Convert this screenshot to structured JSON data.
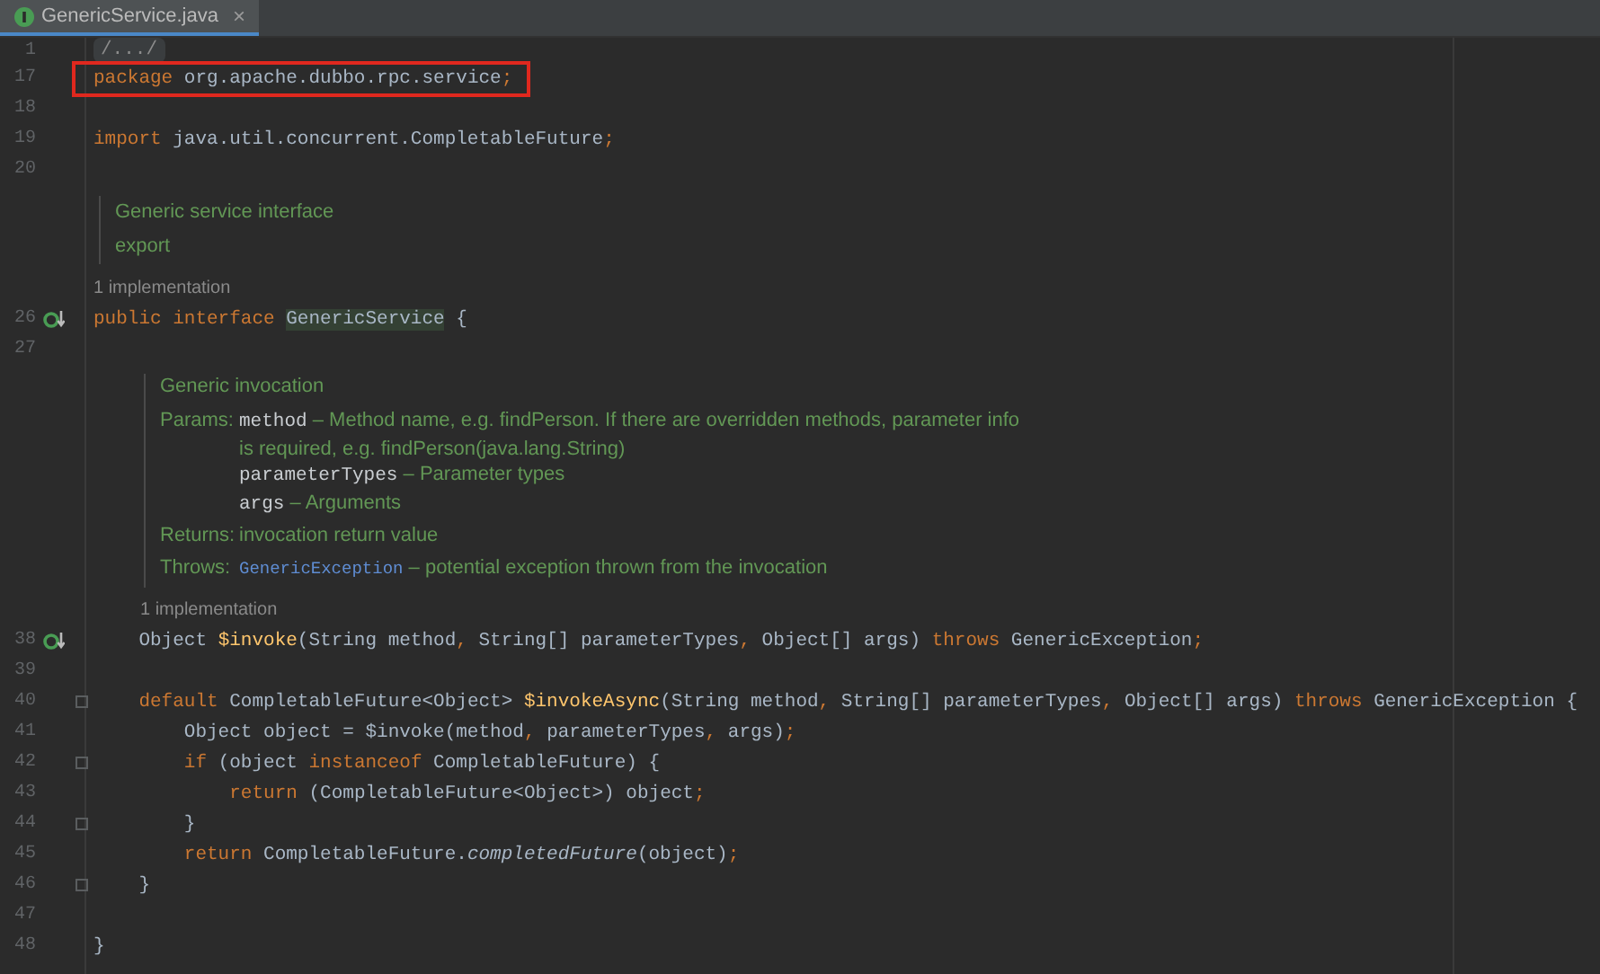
{
  "tab": {
    "label": "GenericService.java",
    "selected": true,
    "close": "×"
  },
  "lines": [
    {
      "kind": "folded",
      "number": "1",
      "text": "/.../"
    },
    {
      "kind": "code",
      "number": "17",
      "boxed": true,
      "tokens": [
        {
          "kind": "kw",
          "text": "package "
        },
        {
          "kind": "plain",
          "text": "org.apache.dubbo.rpc.service"
        },
        {
          "kind": "punct",
          "text": ";"
        }
      ]
    },
    {
      "kind": "blank",
      "number": "18"
    },
    {
      "kind": "code",
      "number": "19",
      "tokens": [
        {
          "kind": "kw",
          "text": "import "
        },
        {
          "kind": "plain",
          "text": "java.util.concurrent.CompletableFuture"
        },
        {
          "kind": "punct",
          "text": ";"
        }
      ]
    },
    {
      "kind": "blank",
      "number": "20"
    },
    {
      "kind": "doc",
      "paragraphs": [
        "Generic service interface",
        "export"
      ]
    },
    {
      "kind": "hint",
      "text": "1 implementation"
    },
    {
      "kind": "code",
      "number": "26",
      "implemented": true,
      "tokens": [
        {
          "kind": "kw",
          "text": "public interface "
        },
        {
          "kind": "hl",
          "text": "GenericService"
        },
        {
          "kind": "plain",
          "text": " {"
        }
      ]
    },
    {
      "kind": "blank",
      "number": "27"
    },
    {
      "kind": "member_doc",
      "paragraphs": [
        "Generic invocation"
      ],
      "sections": [
        {
          "label": "Params:",
          "rows": [
            [
              {
                "kind": "code",
                "text": "method"
              },
              {
                "kind": "text",
                "text": " – Method name, e.g. findPerson. If there are overridden methods, parameter info"
              }
            ],
            [
              {
                "kind": "text",
                "text": "is required, e.g. findPerson(java.lang.String)"
              }
            ],
            [
              {
                "kind": "code",
                "text": "parameterTypes"
              },
              {
                "kind": "text",
                "text": " – Parameter types"
              }
            ],
            [
              {
                "kind": "code",
                "text": "args"
              },
              {
                "kind": "text",
                "text": " – Arguments"
              }
            ]
          ]
        },
        {
          "label": "Returns:",
          "rows": [
            [
              {
                "kind": "text",
                "text": "invocation return value"
              }
            ]
          ]
        },
        {
          "label": "Throws:",
          "rows": [
            [
              {
                "kind": "link",
                "text": "GenericException"
              },
              {
                "kind": "text",
                "text": " – potential exception thrown from the invocation"
              }
            ]
          ]
        }
      ]
    },
    {
      "kind": "member_hint",
      "text": "1 implementation"
    },
    {
      "kind": "code",
      "number": "38",
      "implemented": true,
      "tokens": [
        {
          "kind": "plain",
          "text": "    Object "
        },
        {
          "kind": "decl",
          "text": "$invoke"
        },
        {
          "kind": "plain",
          "text": "(String method"
        },
        {
          "kind": "punct",
          "text": ", "
        },
        {
          "kind": "plain",
          "text": "String[] parameterTypes"
        },
        {
          "kind": "punct",
          "text": ", "
        },
        {
          "kind": "plain",
          "text": "Object[] args) "
        },
        {
          "kind": "kw",
          "text": "throws "
        },
        {
          "kind": "plain",
          "text": "GenericException"
        },
        {
          "kind": "punct",
          "text": ";"
        }
      ]
    },
    {
      "kind": "blank",
      "number": "39"
    },
    {
      "kind": "code",
      "number": "40",
      "fold": true,
      "tokens": [
        {
          "kind": "kw",
          "text": "    default "
        },
        {
          "kind": "plain",
          "text": "CompletableFuture<Object> "
        },
        {
          "kind": "decl",
          "text": "$invokeAsync"
        },
        {
          "kind": "plain",
          "text": "(String method"
        },
        {
          "kind": "punct",
          "text": ", "
        },
        {
          "kind": "plain",
          "text": "String[] parameterTypes"
        },
        {
          "kind": "punct",
          "text": ", "
        },
        {
          "kind": "plain",
          "text": "Object[] args) "
        },
        {
          "kind": "kw",
          "text": "throws "
        },
        {
          "kind": "plain",
          "text": "GenericException {"
        }
      ]
    },
    {
      "kind": "code",
      "number": "41",
      "tokens": [
        {
          "kind": "plain",
          "text": "        Object object = $invoke(method"
        },
        {
          "kind": "punct",
          "text": ", "
        },
        {
          "kind": "plain",
          "text": "parameterTypes"
        },
        {
          "kind": "punct",
          "text": ", "
        },
        {
          "kind": "plain",
          "text": "args)"
        },
        {
          "kind": "punct",
          "text": ";"
        }
      ]
    },
    {
      "kind": "code",
      "number": "42",
      "fold": true,
      "tokens": [
        {
          "kind": "kw",
          "text": "        if "
        },
        {
          "kind": "plain",
          "text": "(object "
        },
        {
          "kind": "kw",
          "text": "instanceof "
        },
        {
          "kind": "plain",
          "text": "CompletableFuture) {"
        }
      ]
    },
    {
      "kind": "code",
      "number": "43",
      "tokens": [
        {
          "kind": "kw",
          "text": "            return "
        },
        {
          "kind": "plain",
          "text": "(CompletableFuture<Object>) object"
        },
        {
          "kind": "punct",
          "text": ";"
        }
      ]
    },
    {
      "kind": "code",
      "number": "44",
      "fold": true,
      "tokens": [
        {
          "kind": "plain",
          "text": "        }"
        }
      ]
    },
    {
      "kind": "code",
      "number": "45",
      "tokens": [
        {
          "kind": "kw",
          "text": "        return "
        },
        {
          "kind": "plain",
          "text": "CompletableFuture."
        },
        {
          "kind": "italic",
          "text": "completedFuture"
        },
        {
          "kind": "plain",
          "text": "(object)"
        },
        {
          "kind": "punct",
          "text": ";"
        }
      ]
    },
    {
      "kind": "code",
      "number": "46",
      "fold": true,
      "tokens": [
        {
          "kind": "plain",
          "text": "    }"
        }
      ]
    },
    {
      "kind": "blank",
      "number": "47"
    },
    {
      "kind": "code",
      "number": "48",
      "tokens": [
        {
          "kind": "plain",
          "text": "}"
        }
      ]
    }
  ]
}
